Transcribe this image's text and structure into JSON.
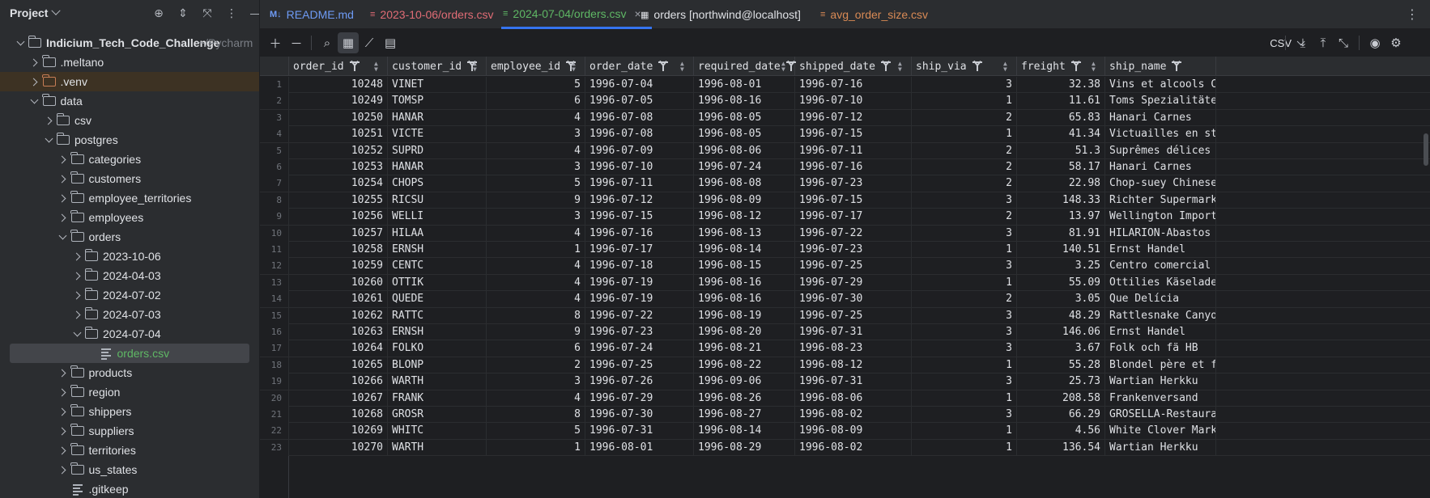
{
  "project_panel": {
    "title": "Project",
    "tree": [
      {
        "label": "Indicium_Tech_Code_Challenge",
        "suffix": "~/Pycharm",
        "kind": "folder",
        "depth": 0,
        "expanded": true,
        "bold": true
      },
      {
        "label": ".meltano",
        "kind": "folder",
        "depth": 1,
        "expanded": false
      },
      {
        "label": ".venv",
        "kind": "folder",
        "depth": 1,
        "expanded": false,
        "excluded": true
      },
      {
        "label": "data",
        "kind": "folder",
        "depth": 1,
        "expanded": true
      },
      {
        "label": "csv",
        "kind": "folder",
        "depth": 2,
        "expanded": false
      },
      {
        "label": "postgres",
        "kind": "folder",
        "depth": 2,
        "expanded": true
      },
      {
        "label": "categories",
        "kind": "folder",
        "depth": 3,
        "expanded": false
      },
      {
        "label": "customers",
        "kind": "folder",
        "depth": 3,
        "expanded": false
      },
      {
        "label": "employee_territories",
        "kind": "folder",
        "depth": 3,
        "expanded": false
      },
      {
        "label": "employees",
        "kind": "folder",
        "depth": 3,
        "expanded": false
      },
      {
        "label": "orders",
        "kind": "folder",
        "depth": 3,
        "expanded": true
      },
      {
        "label": "2023-10-06",
        "kind": "folder",
        "depth": 4,
        "expanded": false
      },
      {
        "label": "2024-04-03",
        "kind": "folder",
        "depth": 4,
        "expanded": false
      },
      {
        "label": "2024-07-02",
        "kind": "folder",
        "depth": 4,
        "expanded": false
      },
      {
        "label": "2024-07-03",
        "kind": "folder",
        "depth": 4,
        "expanded": false
      },
      {
        "label": "2024-07-04",
        "kind": "folder",
        "depth": 4,
        "expanded": true
      },
      {
        "label": "orders.csv",
        "kind": "file",
        "depth": 5,
        "selected": true
      },
      {
        "label": "products",
        "kind": "folder",
        "depth": 3,
        "expanded": false
      },
      {
        "label": "region",
        "kind": "folder",
        "depth": 3,
        "expanded": false
      },
      {
        "label": "shippers",
        "kind": "folder",
        "depth": 3,
        "expanded": false
      },
      {
        "label": "suppliers",
        "kind": "folder",
        "depth": 3,
        "expanded": false
      },
      {
        "label": "territories",
        "kind": "folder",
        "depth": 3,
        "expanded": false
      },
      {
        "label": "us_states",
        "kind": "folder",
        "depth": 3,
        "expanded": false
      },
      {
        "label": ".gitkeep",
        "kind": "file",
        "depth": 3
      }
    ]
  },
  "tabs": [
    {
      "label": "README.md",
      "icon": "markdown-icon",
      "color": "#6e9bf5",
      "active": false
    },
    {
      "label": "2023-10-06/orders.csv",
      "icon": "csv-file-icon",
      "color": "#e06c75",
      "active": false
    },
    {
      "label": "2024-07-04/orders.csv",
      "icon": "csv-file-icon",
      "color": "#5fb865",
      "active": true,
      "close": "×"
    },
    {
      "label": "orders [northwind@localhost]",
      "icon": "table-icon",
      "color": "#dfe1e5",
      "active": false
    },
    {
      "label": "avg_order_size.csv",
      "icon": "csv-file-icon",
      "color": "#d98a55",
      "active": false
    }
  ],
  "toolbar": {
    "format": "CSV"
  },
  "grid": {
    "columns": [
      "order_id",
      "customer_id",
      "employee_id",
      "order_date",
      "required_date",
      "shipped_date",
      "ship_via",
      "freight",
      "ship_name"
    ],
    "rows": [
      [
        "1",
        "10248",
        "VINET",
        "5",
        "1996-07-04",
        "1996-08-01",
        "1996-07-16",
        "3",
        "32.38",
        "Vins et alcools Chevalier"
      ],
      [
        "2",
        "10249",
        "TOMSP",
        "6",
        "1996-07-05",
        "1996-08-16",
        "1996-07-10",
        "1",
        "11.61",
        "Toms Spezialitäten"
      ],
      [
        "3",
        "10250",
        "HANAR",
        "4",
        "1996-07-08",
        "1996-08-05",
        "1996-07-12",
        "2",
        "65.83",
        "Hanari Carnes"
      ],
      [
        "4",
        "10251",
        "VICTE",
        "3",
        "1996-07-08",
        "1996-08-05",
        "1996-07-15",
        "1",
        "41.34",
        "Victuailles en stock"
      ],
      [
        "5",
        "10252",
        "SUPRD",
        "4",
        "1996-07-09",
        "1996-08-06",
        "1996-07-11",
        "2",
        "51.3",
        "Suprêmes délices"
      ],
      [
        "6",
        "10253",
        "HANAR",
        "3",
        "1996-07-10",
        "1996-07-24",
        "1996-07-16",
        "2",
        "58.17",
        "Hanari Carnes"
      ],
      [
        "7",
        "10254",
        "CHOPS",
        "5",
        "1996-07-11",
        "1996-08-08",
        "1996-07-23",
        "2",
        "22.98",
        "Chop-suey Chinese"
      ],
      [
        "8",
        "10255",
        "RICSU",
        "9",
        "1996-07-12",
        "1996-08-09",
        "1996-07-15",
        "3",
        "148.33",
        "Richter Supermarkt"
      ],
      [
        "9",
        "10256",
        "WELLI",
        "3",
        "1996-07-15",
        "1996-08-12",
        "1996-07-17",
        "2",
        "13.97",
        "Wellington Importadora"
      ],
      [
        "10",
        "10257",
        "HILAA",
        "4",
        "1996-07-16",
        "1996-08-13",
        "1996-07-22",
        "3",
        "81.91",
        "HILARION-Abastos"
      ],
      [
        "11",
        "10258",
        "ERNSH",
        "1",
        "1996-07-17",
        "1996-08-14",
        "1996-07-23",
        "1",
        "140.51",
        "Ernst Handel"
      ],
      [
        "12",
        "10259",
        "CENTC",
        "4",
        "1996-07-18",
        "1996-08-15",
        "1996-07-25",
        "3",
        "3.25",
        "Centro comercial Moctezuma"
      ],
      [
        "13",
        "10260",
        "OTTIK",
        "4",
        "1996-07-19",
        "1996-08-16",
        "1996-07-29",
        "1",
        "55.09",
        "Ottilies Käseladen"
      ],
      [
        "14",
        "10261",
        "QUEDE",
        "4",
        "1996-07-19",
        "1996-08-16",
        "1996-07-30",
        "2",
        "3.05",
        "Que Delícia"
      ],
      [
        "15",
        "10262",
        "RATTC",
        "8",
        "1996-07-22",
        "1996-08-19",
        "1996-07-25",
        "3",
        "48.29",
        "Rattlesnake Canyon Grocery"
      ],
      [
        "16",
        "10263",
        "ERNSH",
        "9",
        "1996-07-23",
        "1996-08-20",
        "1996-07-31",
        "3",
        "146.06",
        "Ernst Handel"
      ],
      [
        "17",
        "10264",
        "FOLKO",
        "6",
        "1996-07-24",
        "1996-08-21",
        "1996-08-23",
        "3",
        "3.67",
        "Folk och fä HB"
      ],
      [
        "18",
        "10265",
        "BLONP",
        "2",
        "1996-07-25",
        "1996-08-22",
        "1996-08-12",
        "1",
        "55.28",
        "Blondel père et fils"
      ],
      [
        "19",
        "10266",
        "WARTH",
        "3",
        "1996-07-26",
        "1996-09-06",
        "1996-07-31",
        "3",
        "25.73",
        "Wartian Herkku"
      ],
      [
        "20",
        "10267",
        "FRANK",
        "4",
        "1996-07-29",
        "1996-08-26",
        "1996-08-06",
        "1",
        "208.58",
        "Frankenversand"
      ],
      [
        "21",
        "10268",
        "GROSR",
        "8",
        "1996-07-30",
        "1996-08-27",
        "1996-08-02",
        "3",
        "66.29",
        "GROSELLA-Restaurante"
      ],
      [
        "22",
        "10269",
        "WHITC",
        "5",
        "1996-07-31",
        "1996-08-14",
        "1996-08-09",
        "1",
        "4.56",
        "White Clover Markets"
      ],
      [
        "23",
        "10270",
        "WARTH",
        "1",
        "1996-08-01",
        "1996-08-29",
        "1996-08-02",
        "1",
        "136.54",
        "Wartian Herkku"
      ]
    ]
  }
}
